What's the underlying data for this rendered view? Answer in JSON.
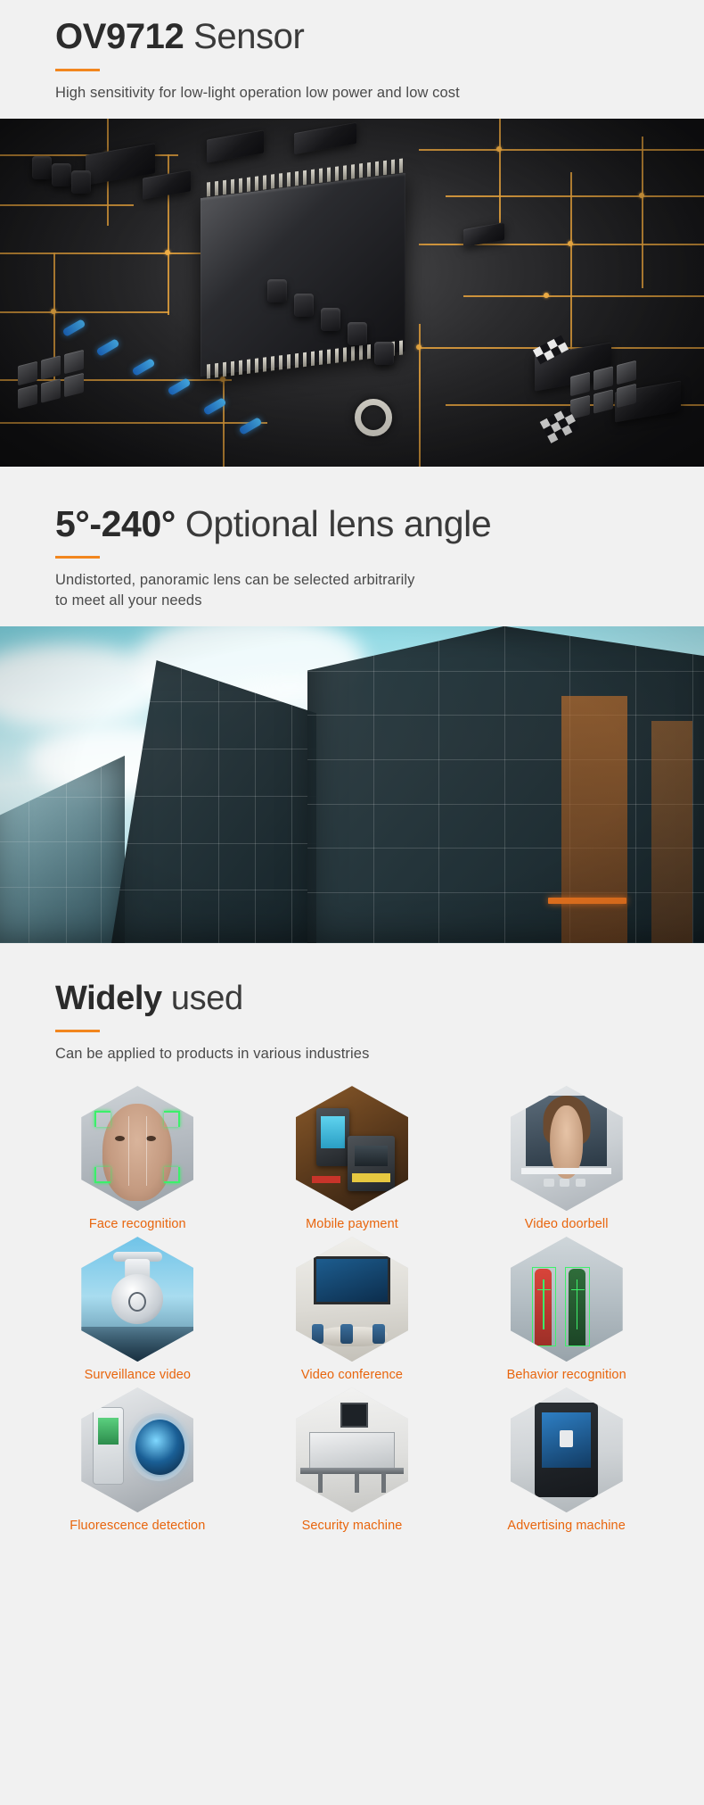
{
  "sections": [
    {
      "heading_bold": "OV9712",
      "heading_light": " Sensor",
      "subtitle": "High sensitivity for low-light operation low power and low cost",
      "image_name": "circuit-board-photo"
    },
    {
      "heading_bold": "5°-240°",
      "heading_light": " Optional lens angle",
      "subtitle_line1": "Undistorted, panoramic lens can be selected arbitrarily",
      "subtitle_line2": "to meet all your needs",
      "image_name": "glass-building-photo"
    },
    {
      "heading_bold": "Widely",
      "heading_light": " used",
      "subtitle": "Can be applied to products in various industries"
    }
  ],
  "applications": [
    {
      "label": "Face recognition",
      "art": "art-face"
    },
    {
      "label": "Mobile payment",
      "art": "art-pay"
    },
    {
      "label": "Video doorbell",
      "art": "art-door"
    },
    {
      "label": "Surveillance video",
      "art": "art-surv"
    },
    {
      "label": "Video conference",
      "art": "art-conf"
    },
    {
      "label": "Behavior recognition",
      "art": "art-beh"
    },
    {
      "label": "Fluorescence detection",
      "art": "art-fluo"
    },
    {
      "label": "Security machine",
      "art": "art-sec"
    },
    {
      "label": "Advertising machine",
      "art": "art-adv"
    }
  ],
  "colors": {
    "accent_orange": "#f2861e",
    "label_orange": "#e8650d",
    "heading_dark": "#2b2b2b",
    "body_text": "#4a4a4a",
    "page_background": "#f1f1f1"
  }
}
